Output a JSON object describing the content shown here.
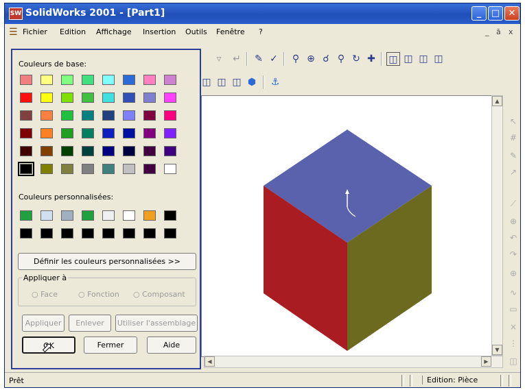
{
  "window": {
    "app_icon_text": "SW",
    "title": "SolidWorks 2001 - [Part1]",
    "minimize": "_",
    "maximize": "□",
    "close": "✕"
  },
  "menubar": {
    "items": [
      "Fichier",
      "Edition",
      "Affichage",
      "Insertion",
      "Outils",
      "Fenêtre",
      "?"
    ],
    "mdi_controls": [
      "_",
      "ā",
      "x"
    ]
  },
  "dialog": {
    "basic_colors_label": "Couleurs de base:",
    "basic_colors": [
      [
        "#f08080",
        "#ffff80",
        "#80ff80",
        "#40e080",
        "#80ffff",
        "#2a6bd8",
        "#ff80c0",
        "#d080d0"
      ],
      [
        "#ff1010",
        "#ffff10",
        "#80e000",
        "#40c040",
        "#40e0e0",
        "#3050b8",
        "#8080d0",
        "#ff40ff"
      ],
      [
        "#804040",
        "#ff8040",
        "#20c040",
        "#008080",
        "#204080",
        "#8080ff",
        "#800040",
        "#ff0080"
      ],
      [
        "#800000",
        "#ff8020",
        "#20a020",
        "#008060",
        "#1020c0",
        "#0010a0",
        "#800080",
        "#8020ff"
      ],
      [
        "#400000",
        "#804000",
        "#004000",
        "#004040",
        "#000080",
        "#000040",
        "#400040",
        "#400080"
      ],
      [
        "#000000",
        "#808000",
        "#808040",
        "#808080",
        "#408080",
        "#c0c0c0",
        "#400040",
        "#ffffff"
      ]
    ],
    "custom_colors_label": "Couleurs personnalisées:",
    "custom_colors": [
      [
        "#20a040",
        "#d0e0f0",
        "#a0b0c0",
        "#20a040",
        "#f0f0f0",
        "#ffffff",
        "#f0a020",
        "#000000"
      ],
      [
        "#000000",
        "#000000",
        "#000000",
        "#000000",
        "#000000",
        "#000000",
        "#000000",
        "#000000"
      ]
    ],
    "define_custom_button": "Définir les couleurs personnalisées >>",
    "apply_to": {
      "legend": "Appliquer à",
      "options": [
        "Face",
        "Fonction",
        "Composant"
      ]
    },
    "buttons": {
      "apply": "Appliquer",
      "remove": "Enlever",
      "use_assembly": "Utiliser l'assemblage",
      "ok": "OK",
      "close": "Fermer",
      "help": "Aide"
    }
  },
  "cube": {
    "top_color": "#5a62ad",
    "left_color": "#a81c22",
    "right_color": "#6c6a1f"
  },
  "statusbar": {
    "left": "Prêt",
    "right": "Edition: Pièce"
  }
}
